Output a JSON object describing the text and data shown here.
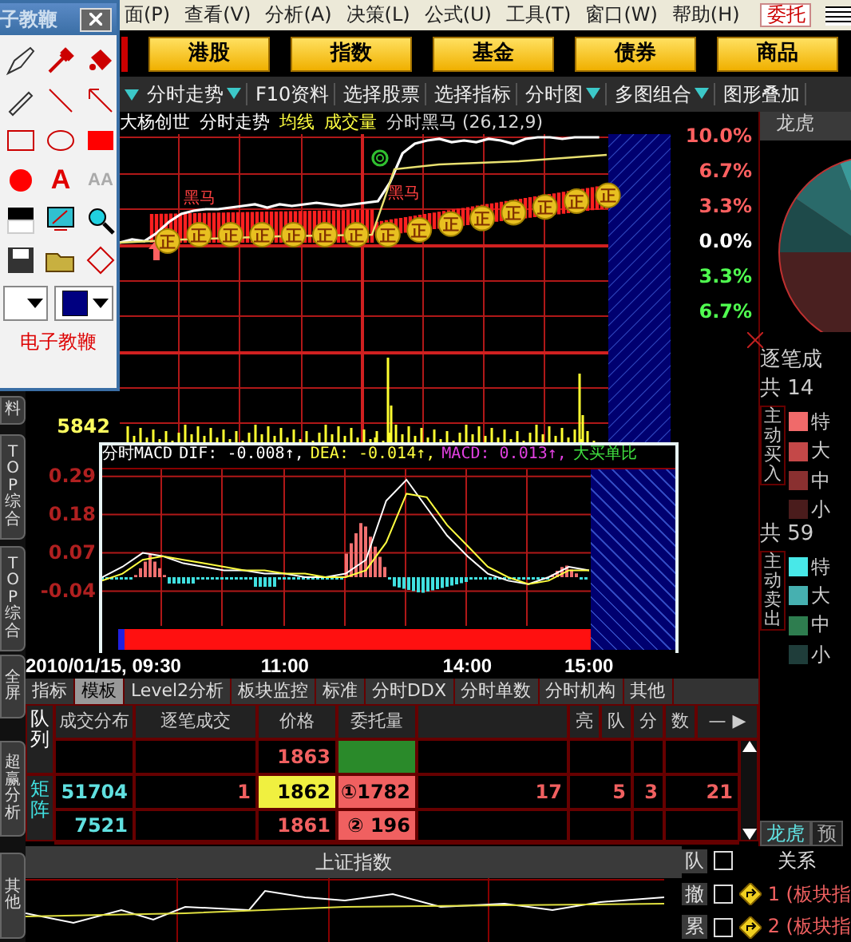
{
  "menu": [
    "面(P)",
    "查看(V)",
    "分析(A)",
    "决策(L)",
    "公式(U)",
    "工具(T)",
    "窗口(W)",
    "帮助(H)"
  ],
  "order_button": "委托",
  "market_buttons": [
    "港股",
    "指数",
    "基金",
    "债券",
    "商品"
  ],
  "toolbar": [
    {
      "label": "分时走势",
      "has_menu": true
    },
    {
      "label": "F10资料",
      "has_menu": false
    },
    {
      "label": "选择股票",
      "has_menu": false
    },
    {
      "label": "选择指标",
      "has_menu": false
    },
    {
      "label": "分时图",
      "has_menu": true
    },
    {
      "label": "多图组合",
      "has_menu": true
    },
    {
      "label": "图形叠加",
      "has_menu": false
    }
  ],
  "tool_window": {
    "title": "子教鞭",
    "text_tools": [
      "A",
      "AA"
    ],
    "label": "电子教鞭"
  },
  "side_tabs": [
    "料",
    "TOP综合",
    "TOP综合",
    "全屏",
    "超赢分析",
    "其他"
  ],
  "chart_header": [
    {
      "text": "大杨创世",
      "kind": "title"
    },
    {
      "text": "分时走势",
      "kind": "title"
    },
    {
      "text": "均线",
      "kind": "indicator"
    },
    {
      "text": "成交量",
      "kind": "indicator"
    },
    {
      "text": "分时黑马 (26,12,9)",
      "kind": "param"
    }
  ],
  "price_axis": [
    {
      "text": "10.0%",
      "kind": "up"
    },
    {
      "text": "6.7%",
      "kind": "up"
    },
    {
      "text": "3.3%",
      "kind": "up"
    },
    {
      "text": "0.0%",
      "kind": "flat"
    },
    {
      "text": "3.3%",
      "kind": "down"
    },
    {
      "text": "6.7%",
      "kind": "down"
    }
  ],
  "signal_markers": [
    "正",
    "正",
    "正",
    "正",
    "正",
    "正",
    "正",
    "正",
    "正",
    "正",
    "正",
    "正",
    "正",
    "正",
    "正"
  ],
  "horse_labels": [
    "黑马",
    "黑马"
  ],
  "volume_label": "5842",
  "macd": {
    "title": "分时MACD",
    "readings": [
      ": -0.008↑,",
      ": -0.014↑,",
      ": 0.013↑,"
    ],
    "extra_label": "大买单比",
    "histogram": {
      "label": "MACD",
      "color": "#e040e0"
    },
    "histogram_colors": [
      {
        "color": "#f07070"
      },
      {
        "color": "#40e0e0"
      }
    ],
    "chart_data": {
      "type": "line",
      "grid": true,
      "ylim": [
        -0.14,
        0.31
      ],
      "yticks": [
        0.29,
        0.18,
        0.07,
        -0.04
      ],
      "categories": [
        "2010/01/15, 09:30",
        null,
        null,
        null,
        null,
        null,
        null,
        null,
        null,
        "11:00",
        null,
        null,
        null,
        null,
        null,
        null,
        null,
        null,
        "14:00",
        null,
        null,
        null,
        null,
        null,
        "15:00"
      ],
      "series": [
        {
          "name": "DIF",
          "color": "#ffffff",
          "values": [
            0.0,
            0.03,
            0.07,
            0.06,
            0.04,
            0.03,
            0.02,
            0.02,
            0.01,
            0.01,
            0.0,
            0.0,
            0.01,
            0.05,
            0.22,
            0.28,
            0.2,
            0.12,
            0.06,
            0.01,
            -0.01,
            -0.02,
            0.0,
            0.03,
            0.02
          ]
        },
        {
          "name": "DEA",
          "color": "#ffff40",
          "values": [
            -0.01,
            0.01,
            0.05,
            0.06,
            0.05,
            0.04,
            0.03,
            0.02,
            0.02,
            0.01,
            0.01,
            0.0,
            0.0,
            0.02,
            0.1,
            0.24,
            0.23,
            0.15,
            0.09,
            0.03,
            0.0,
            -0.02,
            -0.01,
            0.02,
            0.02
          ]
        }
      ]
    }
  },
  "bottom_tabs": [
    {
      "label": "指标",
      "selected": false
    },
    {
      "label": "模板",
      "selected": true
    },
    {
      "label": "Level2分析",
      "selected": false
    },
    {
      "label": "板块监控",
      "selected": false
    },
    {
      "label": "标准",
      "selected": false
    },
    {
      "label": "分时DDX",
      "selected": false
    },
    {
      "label": "分时单数",
      "selected": false
    },
    {
      "label": "分时机构",
      "selected": false
    },
    {
      "label": "其他",
      "selected": false
    }
  ],
  "queue_table": {
    "side_label": "队列",
    "matrix_label": "矩阵",
    "columns_left": [
      "成交分布",
      "逐笔成交",
      "价格",
      "委托量"
    ],
    "columns_right": [
      "亮",
      "队",
      "分",
      "数"
    ],
    "nav": [
      "—",
      "▶"
    ],
    "rows": [
      {
        "price": "1863",
        "kind": "ask",
        "selected": false,
        "stats": []
      },
      {
        "volume": "51704",
        "trade": "1",
        "price": "1862",
        "order": "①1782",
        "kind": "bid",
        "selected": true,
        "stats": [
          "17",
          "5",
          "3",
          "21"
        ]
      },
      {
        "volume": "7521",
        "price": "1861",
        "order": "② 196",
        "kind": "bid",
        "selected": false,
        "stats": []
      }
    ]
  },
  "right_panel": {
    "title": "龙虎",
    "trade_title": "逐笔成",
    "buy": {
      "total": "共 14",
      "label": "主动买入",
      "legend": [
        {
          "text": "特",
          "color": "#f06a6a"
        },
        {
          "text": "大",
          "color": "#c44848"
        },
        {
          "text": "中",
          "color": "#8a3030"
        },
        {
          "text": "小",
          "color": "#4a1c1c"
        }
      ]
    },
    "sell": {
      "total": "共 59",
      "label": "主动卖出",
      "legend": [
        {
          "text": "特",
          "color": "#48e8e8"
        },
        {
          "text": "大",
          "color": "#46b0b0"
        },
        {
          "text": "中",
          "color": "#2e7d4f"
        },
        {
          "text": "小",
          "color": "#1f3d3a"
        }
      ]
    },
    "tabs": [
      {
        "label": "龙虎",
        "selected": true
      },
      {
        "label": "预",
        "selected": false
      }
    ]
  },
  "index_panel": {
    "title": "上证指数"
  },
  "relations": {
    "header": {
      "side": "队",
      "checked": false,
      "label": "关系"
    },
    "rows": [
      {
        "side": "撤",
        "checked": false,
        "label": "1 (板块指"
      },
      {
        "side": "累",
        "checked": false,
        "label": "2 (板块指"
      }
    ]
  }
}
